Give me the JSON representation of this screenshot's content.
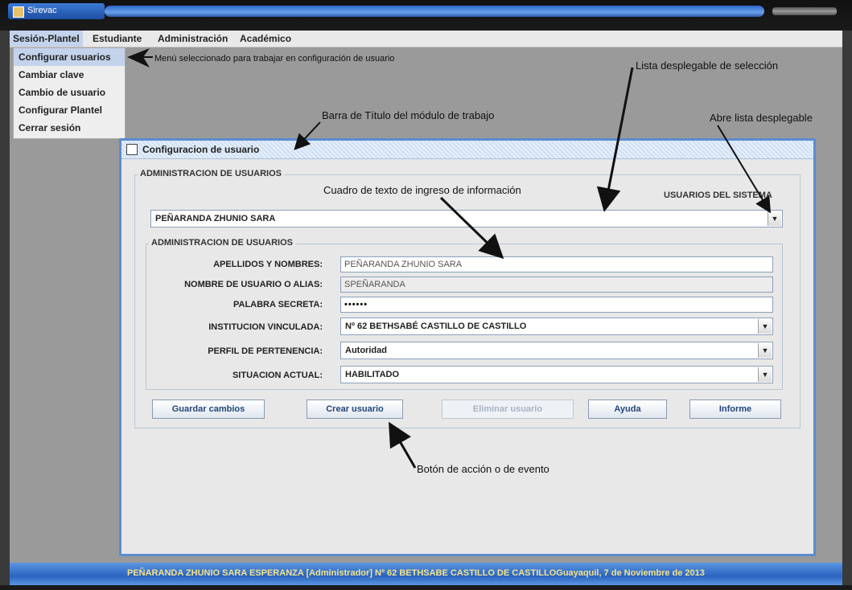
{
  "window": {
    "title": "Sirevac"
  },
  "menubar": {
    "items": [
      "Sesión-Plantel",
      "Estudiante",
      "Administración",
      "Académico"
    ]
  },
  "dropdown_menu": {
    "items": [
      "Configurar usuarios",
      "Cambiar clave",
      "Cambio de usuario",
      "Configurar Plantel",
      "Cerrar sesión"
    ]
  },
  "frame": {
    "title": "Configuracion de usuario",
    "outer_group_label": "ADMINISTRACION DE USUARIOS",
    "users_label": "USUARIOS DEL SISTEMA",
    "users_combo_value": "PEÑARANDA ZHUNIO SARA",
    "inner_group_label": "ADMINISTRACION DE USUARIOS",
    "fields": {
      "apellidos_label": "APELLIDOS Y NOMBRES:",
      "apellidos_value": "PEÑARANDA ZHUNIO SARA",
      "alias_label": "NOMBRE DE USUARIO O ALIAS:",
      "alias_value": "SPEÑARANDA",
      "password_label": "PALABRA SECRETA:",
      "password_value": "••••••",
      "institucion_label": "INSTITUCION VINCULADA:",
      "institucion_value": "Nº 62 BETHSABÉ CASTILLO DE CASTILLO",
      "perfil_label": "PERFIL DE PERTENENCIA:",
      "perfil_value": "Autoridad",
      "situacion_label": "SITUACION ACTUAL:",
      "situacion_value": "HABILITADO"
    },
    "buttons": {
      "guardar": "Guardar cambios",
      "crear": "Crear usuario",
      "eliminar": "Eliminar usuario",
      "ayuda": "Ayuda",
      "informe": "Informe"
    }
  },
  "annotations": {
    "menu": "Menú seleccionado para trabajar en configuración de usuario",
    "lista": "Lista desplegable de selección",
    "barra": "Barra de Título del módulo de trabajo",
    "abre": "Abre lista desplegable",
    "cuadro": "Cuadro de texto de ingreso de información",
    "boton": "Botón de acción o de evento"
  },
  "statusbar": {
    "text": "PEÑARANDA ZHUNIO SARA ESPERANZA [Administrador]  Nº 62 BETHSABE CASTILLO DE CASTILLOGuayaquil, 7 de Noviembre de 2013"
  },
  "colors": {
    "frame_border": "#5b8ccf",
    "button_text": "#24477a",
    "status_text": "#f4e28a"
  }
}
